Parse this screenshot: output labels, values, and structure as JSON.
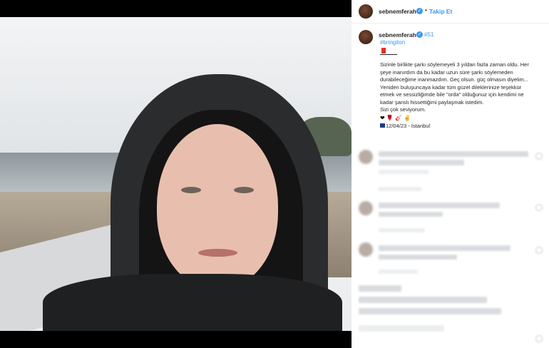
{
  "header": {
    "username": "sebnemferah",
    "follow_label": "Takip Et",
    "separator": "•"
  },
  "post": {
    "username": "sebnemferah",
    "tags": [
      "#51",
      "#bringiton"
    ],
    "caption_lines": [
      "Sizinle birlikte şarkı söylemeyeli 3 yıldan fazla zaman oldu. Her",
      "şeye inanırdım da bu kadar uzun süre şarkı söylemeden",
      "durabileceğime inanmazdım. Geç olsun. güç olmasın diyelim...",
      "Yeniden buluşuncaya kadar tüm güzel dileklerinize teşekkür",
      "etmek ve sessizliğimde bile \"orda\" olduğunuz için kendimi ne",
      "kadar şanslı hissettiğimi paylaşmak istedim.",
      "Sizi çok seviyorum."
    ],
    "emoji_line": "❤ 🌹 🎸 ✌",
    "date_location": "12/04/23 - İstanbul"
  },
  "colors": {
    "accent": "#3897f0",
    "text": "#262626",
    "divider": "#efefef"
  },
  "icons": {
    "verified": "verified-badge-icon",
    "heart": "heart-icon"
  }
}
